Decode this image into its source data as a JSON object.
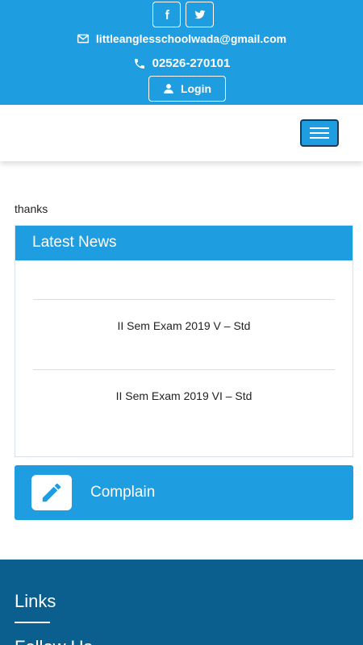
{
  "topbar": {
    "facebook_icon": "facebook-icon",
    "twitter_icon": "twitter-icon",
    "email": "littleanglesschoolwada@gmail.com",
    "phone": "02526-270101",
    "login_label": "Login"
  },
  "main": {
    "intro_text": "thanks",
    "news": {
      "title": "Latest News",
      "items": [
        {
          "label": "II Sem Exam 2019 V – Std"
        },
        {
          "label": "II Sem Exam 2019 VI – Std"
        }
      ]
    },
    "complain": {
      "label": "Complain",
      "icon": "pencil-icon"
    }
  },
  "footer": {
    "links_heading": "Links",
    "follow_heading": "Follow Us"
  },
  "colors": {
    "primary": "#1e9de0",
    "footer_bg": "#0b5f8e",
    "nav_toggle_border": "#1a3c5a"
  }
}
